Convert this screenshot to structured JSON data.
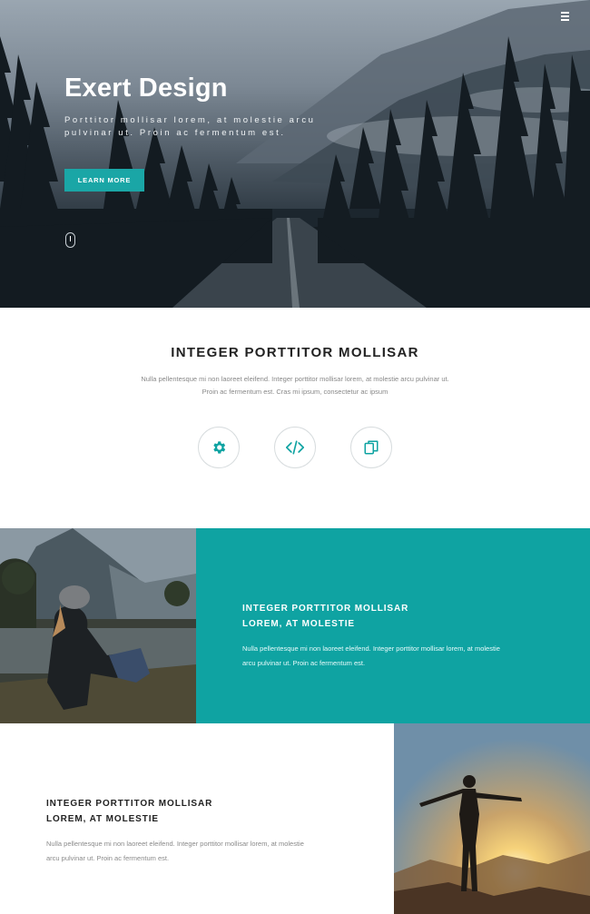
{
  "hero": {
    "title": "Exert Design",
    "text": "Porttitor mollisar lorem, at molestie arcu pulvinar ut. Proin ac fermentum est.",
    "button_label": "LEARN MORE",
    "menu_icon": "hamburger-menu-icon",
    "scroll_icon": "mouse-scroll-icon"
  },
  "intro": {
    "title": "INTEGER PORTTITOR MOLLISAR",
    "text": "Nulla pellentesque mi non laoreet eleifend. Integer porttitor mollisar lorem, at molestie arcu pulvinar ut. Proin ac fermentum est. Cras mi ipsum, consectetur ac ipsum",
    "features": [
      {
        "icon": "gear-icon"
      },
      {
        "icon": "code-icon"
      },
      {
        "icon": "copy-icon"
      }
    ]
  },
  "section2": {
    "heading_line1": "INTEGER PORTTITOR MOLLISAR",
    "heading_line2": "LOREM, AT MOLESTIE",
    "text": "Nulla pellentesque mi non laoreet eleifend. Integer porttitor mollisar lorem, at molestie arcu pulvinar ut. Proin ac fermentum est."
  },
  "section3": {
    "heading_line1": "INTEGER PORTTITOR MOLLISAR",
    "heading_line2": "LOREM, AT MOLESTIE",
    "text": "Nulla pellentesque mi non laoreet eleifend. Integer porttitor mollisar lorem, at molestie arcu pulvinar ut. Proin ac fermentum est."
  },
  "colors": {
    "accent": "#0fa3a2",
    "button": "#1aa6a6",
    "heading": "#222222",
    "body_text": "#888888"
  }
}
